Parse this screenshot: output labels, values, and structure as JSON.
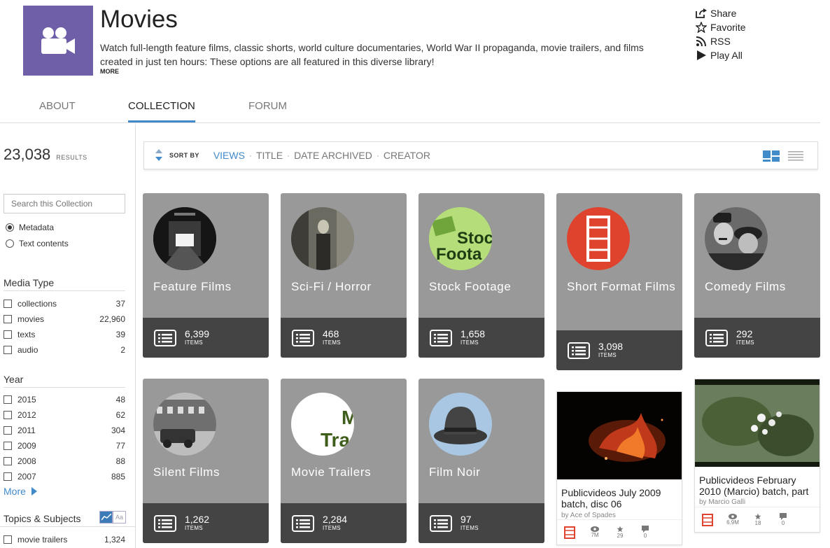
{
  "header": {
    "title": "Movies",
    "description": "Watch full-length feature films, classic shorts, world culture documentaries, World War II propaganda, movie trailers, and films created in just ten hours: These options are all featured in this diverse library!",
    "more": "MORE",
    "icon": "movie-camera-icon",
    "icon_bg": "#6e5fa8",
    "actions": [
      {
        "label": "Share",
        "icon": "share-icon"
      },
      {
        "label": "Favorite",
        "icon": "star-icon"
      },
      {
        "label": "RSS",
        "icon": "rss-icon"
      },
      {
        "label": "Play All",
        "icon": "play-icon"
      }
    ]
  },
  "tabs": [
    {
      "label": "ABOUT"
    },
    {
      "label": "COLLECTION",
      "active": true
    },
    {
      "label": "FORUM"
    }
  ],
  "sidebar": {
    "results_count": "23,038",
    "results_label": "RESULTS",
    "search_placeholder": "Search this Collection",
    "search_options": [
      {
        "label": "Metadata",
        "selected": true
      },
      {
        "label": "Text contents",
        "selected": false
      }
    ],
    "media_type": {
      "heading": "Media Type",
      "items": [
        {
          "label": "collections",
          "count": "37"
        },
        {
          "label": "movies",
          "count": "22,960"
        },
        {
          "label": "texts",
          "count": "39"
        },
        {
          "label": "audio",
          "count": "2"
        }
      ]
    },
    "year": {
      "heading": "Year",
      "items": [
        {
          "label": "2015",
          "count": "48"
        },
        {
          "label": "2012",
          "count": "62"
        },
        {
          "label": "2011",
          "count": "304"
        },
        {
          "label": "2009",
          "count": "77"
        },
        {
          "label": "2008",
          "count": "88"
        },
        {
          "label": "2007",
          "count": "885"
        }
      ],
      "more": "More"
    },
    "topics": {
      "heading": "Topics & Subjects",
      "toggle_text": "Aa",
      "items": [
        {
          "label": "movie trailers",
          "count": "1,324"
        }
      ]
    }
  },
  "sortbar": {
    "label": "SORT BY",
    "options": [
      {
        "label": "VIEWS",
        "active": true
      },
      {
        "label": "TITLE"
      },
      {
        "label": "DATE ARCHIVED"
      },
      {
        "label": "CREATOR"
      }
    ],
    "accent": "#428bca"
  },
  "collections": [
    {
      "title": "Feature Films",
      "count": "6,399",
      "count_label": "ITEMS",
      "image": "theater-screen-image"
    },
    {
      "title": "Sci-Fi / Horror",
      "count": "468",
      "count_label": "ITEMS",
      "image": "figure-in-doorway-image"
    },
    {
      "title": "Stock Footage",
      "count": "1,658",
      "count_label": "ITEMS",
      "image": "stock-footage-logo",
      "image_text": [
        "Stoc",
        "Foota"
      ]
    },
    {
      "title": "Short Format Films",
      "count": "3,098",
      "count_label": "ITEMS",
      "image": "film-strip-icon"
    },
    {
      "title": "Comedy Films",
      "count": "292",
      "count_label": "ITEMS",
      "image": "comedians-image"
    },
    {
      "title": "Silent Films",
      "count": "1,262",
      "count_label": "ITEMS",
      "image": "street-scene-image"
    },
    {
      "title": "Movie Trailers",
      "count": "2,284",
      "count_label": "ITEMS",
      "image": "movie-trailers-logo",
      "image_text": [
        "M",
        "Tra"
      ]
    },
    {
      "title": "Film Noir",
      "count": "97",
      "count_label": "ITEMS",
      "image": "fedora-hat-image"
    }
  ],
  "items": [
    {
      "title": "Publicvideos July 2009 batch, disc 06",
      "by": "by Ace of Spades",
      "views": "7M",
      "favorites": "29",
      "reviews": "0",
      "image": "fire-embers-image"
    },
    {
      "title": "Publicvideos February 2010 (Marcio) batch, part",
      "by": "by Marcio Galli",
      "views": "6.9M",
      "favorites": "18",
      "reviews": "0",
      "image": "white-flowers-image"
    }
  ]
}
